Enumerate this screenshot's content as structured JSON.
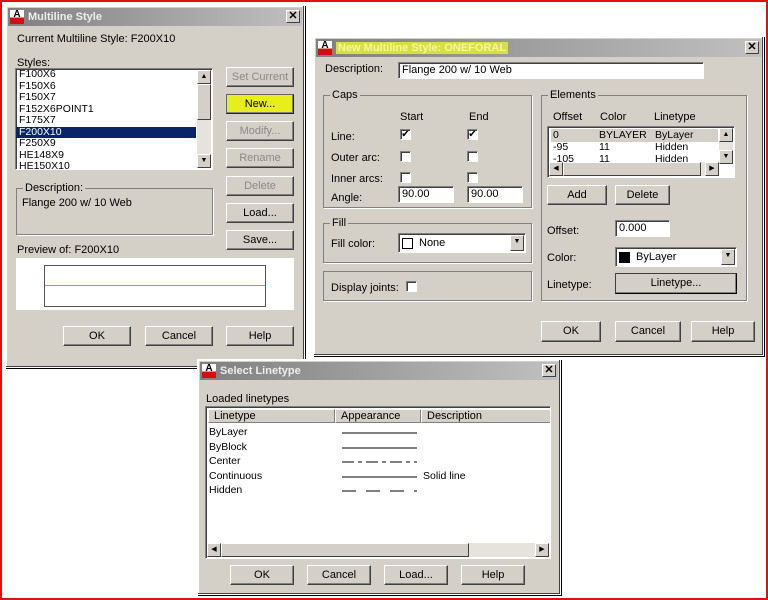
{
  "multiline_style": {
    "title": "Multiline Style",
    "current_label": "Current Multiline Style: F200X10",
    "styles_label": "Styles:",
    "styles": [
      "F100X6",
      "F150X6",
      "F150X7",
      "F152X6POINT1",
      "F175X7",
      "F200X10",
      "F250X9",
      "HE148X9",
      "HE150X10"
    ],
    "selected_index": 5,
    "buttons": {
      "set_current": "Set Current",
      "new": "New...",
      "modify": "Modify...",
      "rename": "Rename",
      "delete": "Delete",
      "load": "Load...",
      "save": "Save..."
    },
    "description_label": "Description:",
    "description": "Flange 200  w/ 10 Web",
    "preview_label": "Preview of: F200X10",
    "ok": "OK",
    "cancel": "Cancel",
    "help": "Help"
  },
  "new_style": {
    "title": "New Multiline Style: ONEFORAL",
    "description_label": "Description:",
    "description": "Flange 200  w/ 10 Web",
    "caps": {
      "label": "Caps",
      "start": "Start",
      "end": "End",
      "line": "Line:",
      "outer_arc": "Outer arc:",
      "inner_arcs": "Inner arcs:",
      "angle": "Angle:",
      "line_start": true,
      "line_end": true,
      "outer_start": false,
      "outer_end": false,
      "inner_start": false,
      "inner_end": false,
      "angle_start": "90.00",
      "angle_end": "90.00"
    },
    "fill": {
      "label": "Fill",
      "fill_color_label": "Fill color:",
      "fill_color": "None"
    },
    "display_joints_label": "Display joints:",
    "elements": {
      "label": "Elements",
      "columns": [
        "Offset",
        "Color",
        "Linetype"
      ],
      "rows": [
        [
          "0",
          "BYLAYER",
          "ByLayer"
        ],
        [
          "-95",
          "11",
          "Hidden"
        ],
        [
          "-105",
          "11",
          "Hidden"
        ]
      ],
      "add": "Add",
      "delete": "Delete",
      "offset_label": "Offset:",
      "offset": "0.000",
      "color_label": "Color:",
      "color": "ByLayer",
      "linetype_label": "Linetype:",
      "linetype_button": "Linetype..."
    },
    "ok": "OK",
    "cancel": "Cancel",
    "help": "Help"
  },
  "select_linetype": {
    "title": "Select Linetype",
    "loaded_label": "Loaded linetypes",
    "columns": [
      "Linetype",
      "Appearance",
      "Description"
    ],
    "rows": [
      {
        "name": "ByLayer",
        "pattern": "solid",
        "description": ""
      },
      {
        "name": "ByBlock",
        "pattern": "solid",
        "description": ""
      },
      {
        "name": "Center",
        "pattern": "center",
        "description": ""
      },
      {
        "name": "Continuous",
        "pattern": "solid",
        "description": "Solid line"
      },
      {
        "name": "Hidden",
        "pattern": "hidden",
        "description": ""
      }
    ],
    "ok": "OK",
    "cancel": "Cancel",
    "load": "Load...",
    "help": "Help"
  }
}
